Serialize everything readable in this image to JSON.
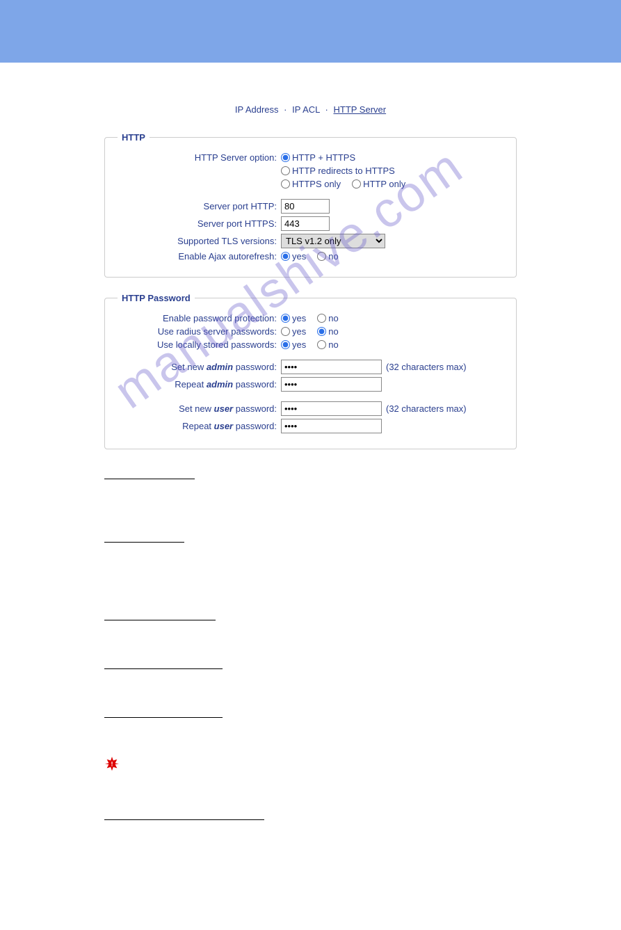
{
  "watermark": "manualshive.com",
  "tabs": {
    "ip_address": "IP Address",
    "ip_acl": "IP ACL",
    "http_server": "HTTP Server",
    "sep": "·"
  },
  "http": {
    "legend": "HTTP",
    "server_option": {
      "label": "HTTP Server option:",
      "opt1": "HTTP + HTTPS",
      "opt2": "HTTP redirects to HTTPS",
      "opt3": "HTTPS only",
      "opt4": "HTTP only"
    },
    "port_http": {
      "label": "Server port HTTP:",
      "value": "80"
    },
    "port_https": {
      "label": "Server port HTTPS:",
      "value": "443"
    },
    "tls": {
      "label": "Supported TLS versions:",
      "value": "TLS v1.2 only"
    },
    "ajax": {
      "label": "Enable Ajax autorefresh:",
      "yes": "yes",
      "no": "no"
    }
  },
  "password": {
    "legend": "HTTP Password",
    "enable": {
      "label": "Enable password protection:",
      "yes": "yes",
      "no": "no"
    },
    "radius": {
      "label": "Use radius server passwords:",
      "yes": "yes",
      "no": "no"
    },
    "local": {
      "label": "Use locally stored passwords:",
      "yes": "yes",
      "no": "no"
    },
    "admin_new_a": "Set new ",
    "admin_new_b": "admin",
    "admin_new_c": " password:",
    "admin_rep_a": "Repeat ",
    "admin_rep_b": "admin",
    "admin_rep_c": " password:",
    "user_new_a": "Set new ",
    "user_new_b": "user",
    "user_new_c": " password:",
    "user_rep_a": "Repeat ",
    "user_rep_b": "user",
    "user_rep_c": " password:",
    "pw_value": "••••",
    "max_hint": "(32 characters max)"
  }
}
